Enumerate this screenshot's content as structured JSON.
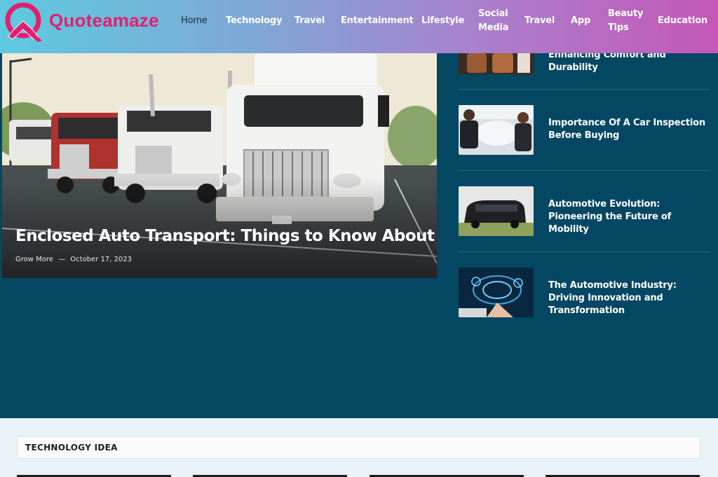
{
  "brand": {
    "name": "Quoteamaze",
    "accent": "#e21f70",
    "header_gradient": [
      "#5ec9df",
      "#c557b7"
    ]
  },
  "nav": {
    "items": [
      {
        "label": "Home",
        "active": true
      },
      {
        "label": "Technology"
      },
      {
        "label": "Travel"
      },
      {
        "label": "Entertainment"
      },
      {
        "label": "Lifestyle"
      },
      {
        "label": "Social Media",
        "lines": [
          "Social",
          "Media"
        ]
      },
      {
        "label": "Travel"
      },
      {
        "label": "App"
      },
      {
        "label": "Beauty Tips",
        "lines": [
          "Beauty",
          "Tips"
        ]
      },
      {
        "label": "Education"
      }
    ]
  },
  "featured": {
    "title": "Enclosed Auto Transport: Things to Know About",
    "author": "Grow More",
    "separator": "—",
    "date": "October 17, 2023",
    "image": "trucks-parked-photo"
  },
  "side_posts": [
    {
      "title": "Enhancing Comfort and Durability",
      "image": "car-seat-photo"
    },
    {
      "title": "Importance Of A Car Inspection Before Buying",
      "image": "mechanics-inspection-photo"
    },
    {
      "title": "Automotive Evolution: Pioneering the Future of Mobility",
      "image": "black-van-photo"
    },
    {
      "title": "The Automotive Industry: Driving Innovation and Transformation",
      "image": "digital-dashboard-photo"
    }
  ],
  "section": {
    "title": "TECHNOLOGY IDEA"
  },
  "colors": {
    "hero_background": "#044763",
    "page_background": "#e8f3f8"
  }
}
